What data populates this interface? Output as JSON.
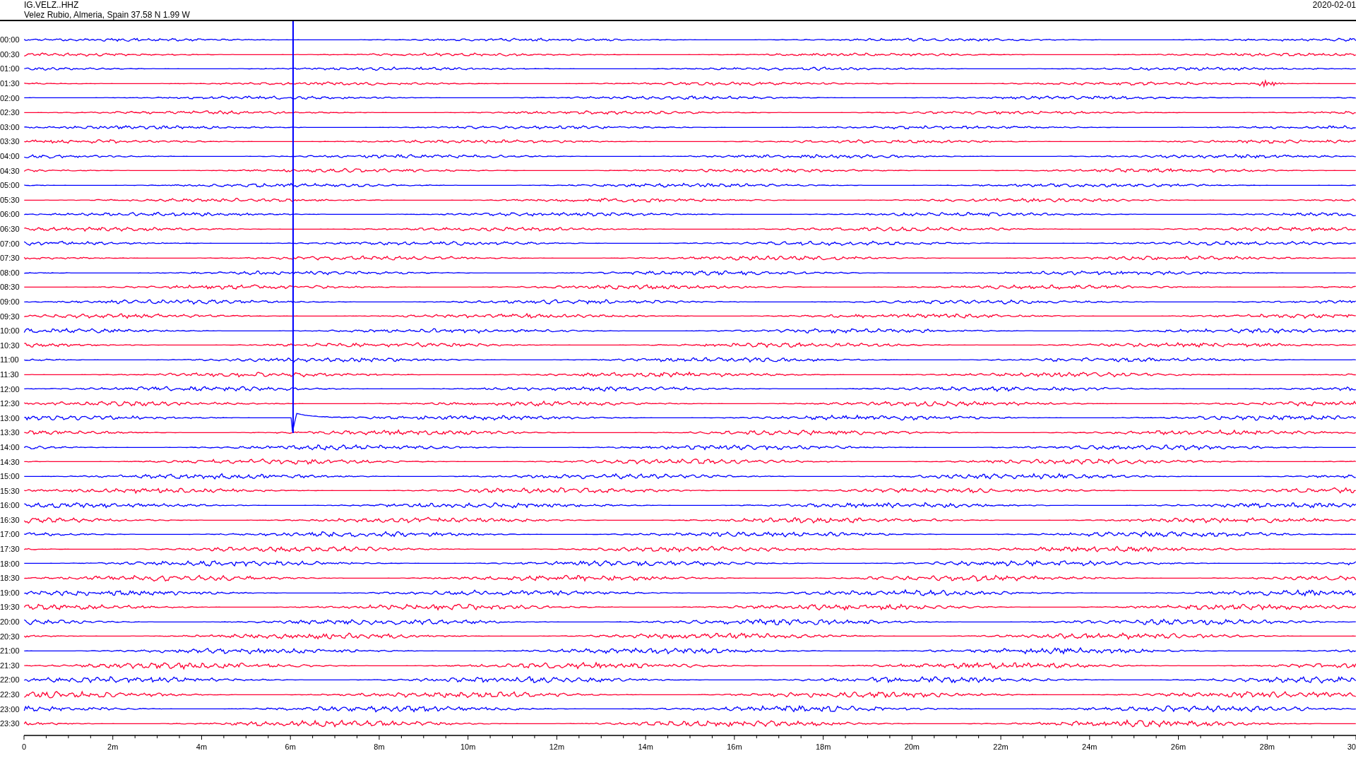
{
  "header": {
    "station": "IG.VELZ..HHZ",
    "location": "Velez Rubio, Almeria, Spain  37.58 N 1.99 W",
    "date": "2020-02-01"
  },
  "rows": [
    {
      "time": "00:00",
      "color": "#0000ff",
      "kind": "noise"
    },
    {
      "time": "00:30",
      "color": "#ff0033",
      "kind": "noise"
    },
    {
      "time": "01:00",
      "color": "#0000ff",
      "kind": "noise"
    },
    {
      "time": "01:30",
      "color": "#ff0033",
      "kind": "burst"
    },
    {
      "time": "02:00",
      "color": "#0000ff",
      "kind": "noise"
    },
    {
      "time": "02:30",
      "color": "#ff0033",
      "kind": "noise"
    },
    {
      "time": "03:00",
      "color": "#0000ff",
      "kind": "noise"
    },
    {
      "time": "03:30",
      "color": "#ff0033",
      "kind": "noise"
    },
    {
      "time": "04:00",
      "color": "#0000ff",
      "kind": "noise"
    },
    {
      "time": "04:30",
      "color": "#ff0033",
      "kind": "noise"
    },
    {
      "time": "05:00",
      "color": "#0000ff",
      "kind": "noise"
    },
    {
      "time": "05:30",
      "color": "#ff0033",
      "kind": "noise"
    },
    {
      "time": "06:00",
      "color": "#0000ff",
      "kind": "noise"
    },
    {
      "time": "06:30",
      "color": "#ff0033",
      "kind": "noise"
    },
    {
      "time": "07:00",
      "color": "#0000ff",
      "kind": "noise"
    },
    {
      "time": "07:30",
      "color": "#ff0033",
      "kind": "noise"
    },
    {
      "time": "08:00",
      "color": "#0000ff",
      "kind": "noise"
    },
    {
      "time": "08:30",
      "color": "#ff0033",
      "kind": "noise"
    },
    {
      "time": "09:00",
      "color": "#0000ff",
      "kind": "noise"
    },
    {
      "time": "09:30",
      "color": "#ff0033",
      "kind": "noise"
    },
    {
      "time": "10:00",
      "color": "#0000ff",
      "kind": "noise"
    },
    {
      "time": "10:30",
      "color": "#ff0033",
      "kind": "noise"
    },
    {
      "time": "11:00",
      "color": "#0000ff",
      "kind": "noise"
    },
    {
      "time": "11:30",
      "color": "#ff0033",
      "kind": "noise"
    },
    {
      "time": "12:00",
      "color": "#0000ff",
      "kind": "noise"
    },
    {
      "time": "12:30",
      "color": "#ff0033",
      "kind": "noise"
    },
    {
      "time": "13:00",
      "color": "#0000ff",
      "kind": "quake"
    },
    {
      "time": "13:30",
      "color": "#ff0033",
      "kind": "noise"
    },
    {
      "time": "14:00",
      "color": "#0000ff",
      "kind": "noise"
    },
    {
      "time": "14:30",
      "color": "#ff0033",
      "kind": "noise"
    },
    {
      "time": "15:00",
      "color": "#0000ff",
      "kind": "noise"
    },
    {
      "time": "15:30",
      "color": "#ff0033",
      "kind": "noise"
    },
    {
      "time": "16:00",
      "color": "#0000ff",
      "kind": "noise"
    },
    {
      "time": "16:30",
      "color": "#ff0033",
      "kind": "noise"
    },
    {
      "time": "17:00",
      "color": "#0000ff",
      "kind": "noise"
    },
    {
      "time": "17:30",
      "color": "#ff0033",
      "kind": "noise"
    },
    {
      "time": "18:00",
      "color": "#0000ff",
      "kind": "noise"
    },
    {
      "time": "18:30",
      "color": "#ff0033",
      "kind": "noise"
    },
    {
      "time": "19:00",
      "color": "#0000ff",
      "kind": "noise"
    },
    {
      "time": "19:30",
      "color": "#ff0033",
      "kind": "noise"
    },
    {
      "time": "20:00",
      "color": "#0000ff",
      "kind": "noise"
    },
    {
      "time": "20:30",
      "color": "#ff0033",
      "kind": "noise"
    },
    {
      "time": "21:00",
      "color": "#0000ff",
      "kind": "noise"
    },
    {
      "time": "21:30",
      "color": "#ff0033",
      "kind": "noise"
    },
    {
      "time": "22:00",
      "color": "#0000ff",
      "kind": "noise"
    },
    {
      "time": "22:30",
      "color": "#ff0033",
      "kind": "noise"
    },
    {
      "time": "23:00",
      "color": "#0000ff",
      "kind": "noise"
    },
    {
      "time": "23:30",
      "color": "#ff0033",
      "kind": "noise"
    }
  ],
  "axis": {
    "labels": [
      "0",
      "2m",
      "4m",
      "6m",
      "8m",
      "10m",
      "12m",
      "14m",
      "16m",
      "18m",
      "20m",
      "22m",
      "24m",
      "26m",
      "28m",
      "30"
    ]
  }
}
